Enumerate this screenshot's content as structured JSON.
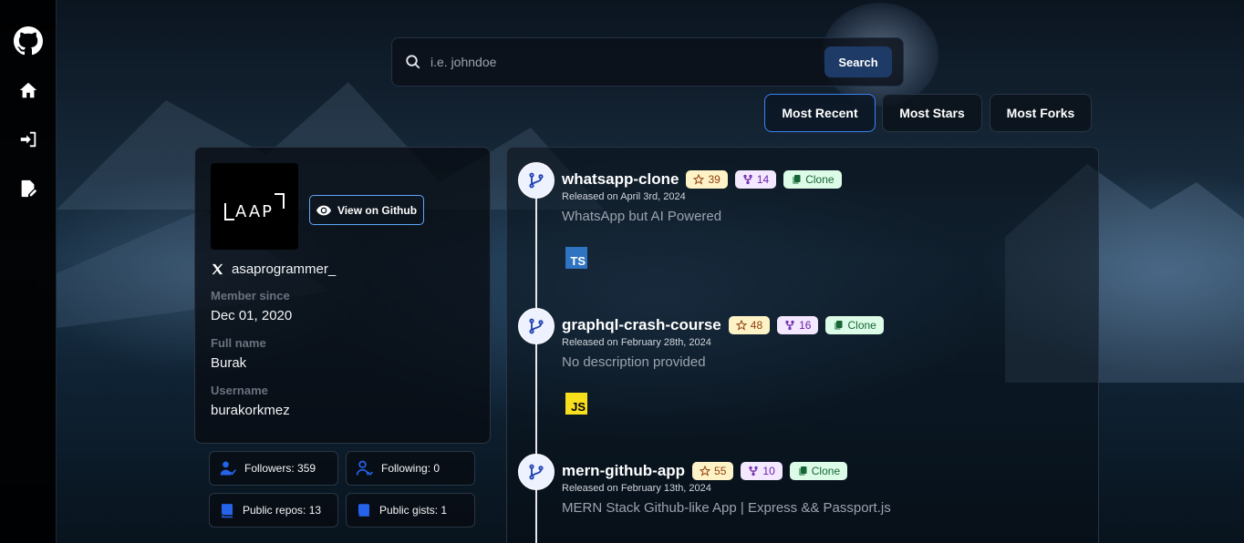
{
  "search": {
    "placeholder": "i.e. johndoe",
    "button_label": "Search"
  },
  "sort": {
    "options": [
      "Most Recent",
      "Most Stars",
      "Most Forks"
    ],
    "selected": "Most Recent"
  },
  "profile": {
    "avatar_text": "AAP",
    "view_button_label": "View on Github",
    "twitter": "asaprogrammer_",
    "member_since_label": "Member since",
    "member_since": "Dec 01, 2020",
    "full_name_label": "Full name",
    "full_name": "Burak",
    "username_label": "Username",
    "username": "burakorkmez"
  },
  "stats": {
    "followers": "Followers: 359",
    "following": "Following: 0",
    "public_repos": "Public repos: 13",
    "public_gists": "Public gists: 1"
  },
  "repos": [
    {
      "name": "whatsapp-clone",
      "stars": "39",
      "forks": "14",
      "clone_label": "Clone",
      "released": "Released on April 3rd, 2024",
      "description": "WhatsApp but AI Powered",
      "language": "TS"
    },
    {
      "name": "graphql-crash-course",
      "stars": "48",
      "forks": "16",
      "clone_label": "Clone",
      "released": "Released on February 28th, 2024",
      "description": "No description provided",
      "language": "JS"
    },
    {
      "name": "mern-github-app",
      "stars": "55",
      "forks": "10",
      "clone_label": "Clone",
      "released": "Released on February 13th, 2024",
      "description": "MERN Stack Github-like App | Express && Passport.js"
    }
  ],
  "colors": {
    "accent": "#3b82f6",
    "search_button": "#1e3a66",
    "stars_badge": "#fef3c7",
    "forks_badge": "#f3e8ff",
    "clone_badge": "#dcfce7"
  }
}
